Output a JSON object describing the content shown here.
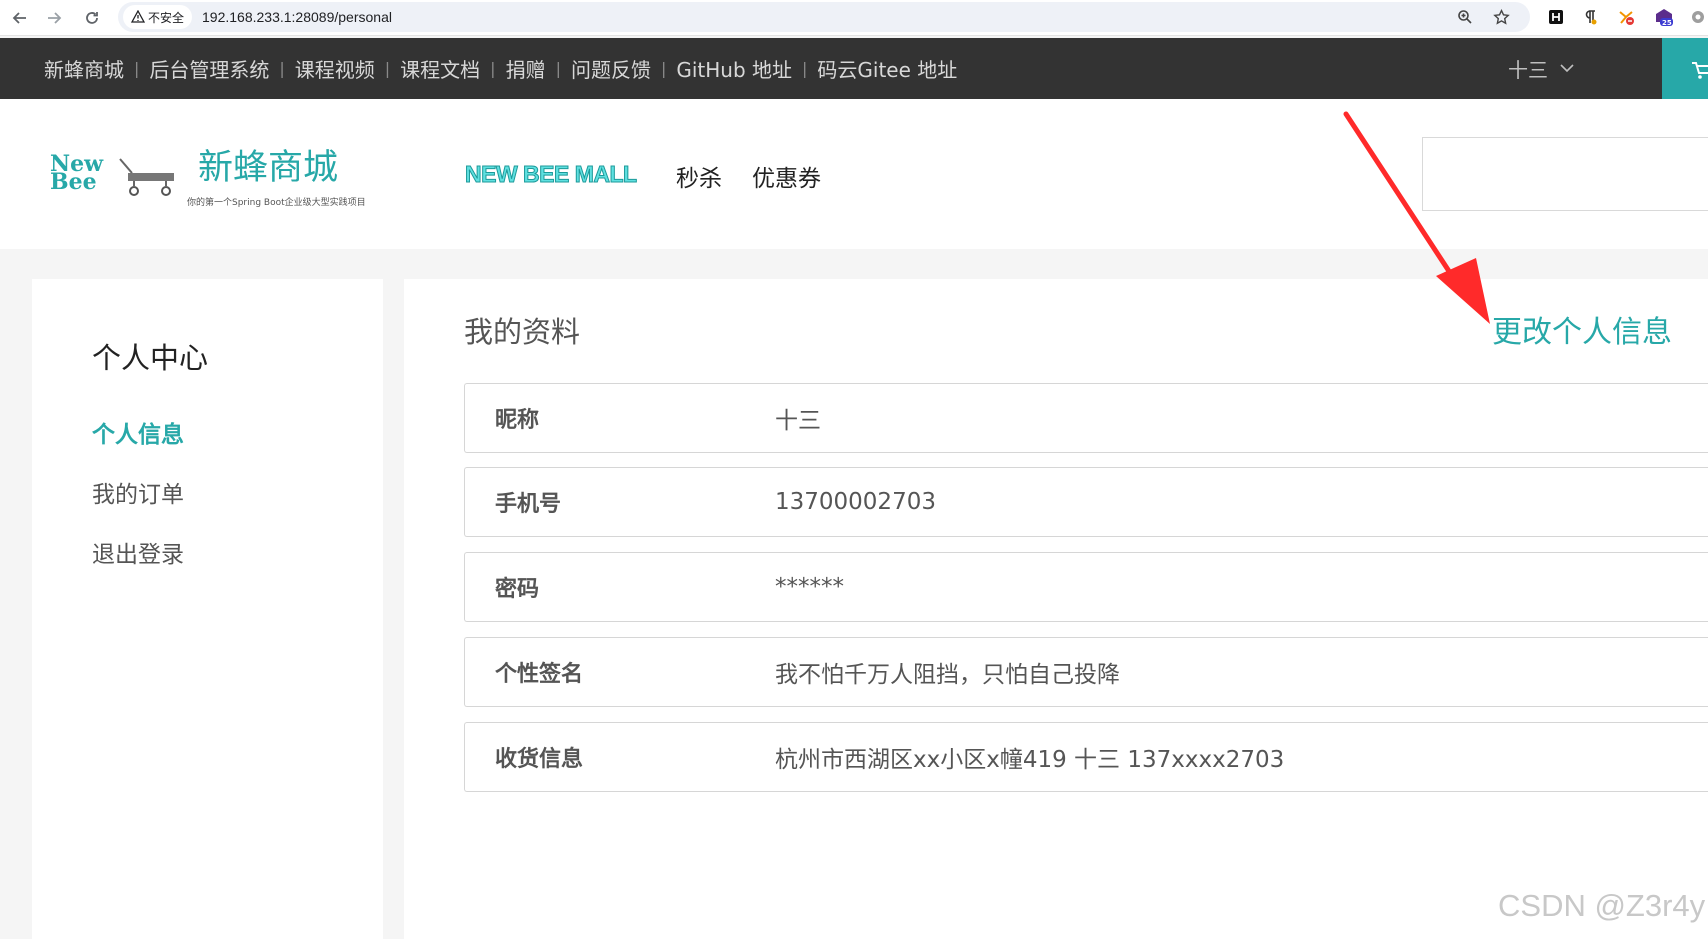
{
  "browser": {
    "insecure_label": "不安全",
    "url": "192.168.233.1:28089/personal"
  },
  "topbar": {
    "links": [
      "新蜂商城",
      "后台管理系统",
      "课程视频",
      "课程文档",
      "捐赠",
      "问题反馈",
      "GitHub 地址",
      "码云Gitee 地址"
    ],
    "username": "十三"
  },
  "header": {
    "logo_line1": "New",
    "logo_line2": "Bee",
    "brand_name": "新蜂商城",
    "slogan": "你的第一个Spring Boot企业级大型实践项目",
    "mall_mark": "NEW BEE MALL",
    "nav": [
      "秒杀",
      "优惠券"
    ]
  },
  "sidebar": {
    "title": "个人中心",
    "items": [
      {
        "label": "个人信息",
        "active": true
      },
      {
        "label": "我的订单",
        "active": false
      },
      {
        "label": "退出登录",
        "active": false
      }
    ]
  },
  "profile": {
    "title": "我的资料",
    "edit_label": "更改个人信息",
    "rows": [
      {
        "label": "昵称",
        "value": "十三"
      },
      {
        "label": "手机号",
        "value": "13700002703"
      },
      {
        "label": "密码",
        "value": "******"
      },
      {
        "label": "个性签名",
        "value": "我不怕千万人阻挡，只怕自己投降"
      },
      {
        "label": "收货信息",
        "value": "杭州市西湖区xx小区x幢419 十三 137xxxx2703"
      }
    ]
  },
  "watermark": "CSDN @Z3r4y",
  "colors": {
    "accent": "#27a8a8",
    "topbar": "#333333",
    "annotation_arrow": "#ff2a2a"
  }
}
